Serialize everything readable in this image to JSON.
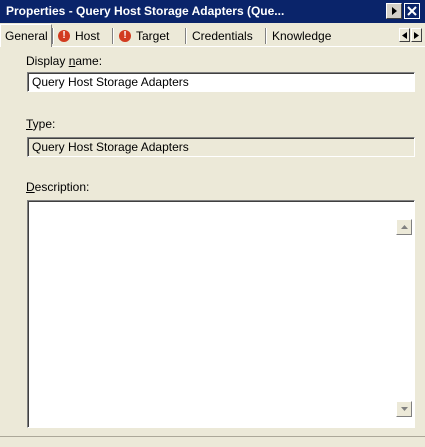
{
  "window": {
    "title": "Properties - Query Host Storage Adapters (Que...",
    "title_bg": "#0a246a"
  },
  "tabs": [
    {
      "label": "General",
      "active": true,
      "icon": null
    },
    {
      "label": "Host",
      "active": false,
      "icon": "warning-icon"
    },
    {
      "label": "Target",
      "active": false,
      "icon": "warning-icon"
    },
    {
      "label": "Credentials",
      "active": false,
      "icon": null
    },
    {
      "label": "Knowledge",
      "active": false,
      "icon": null
    }
  ],
  "form": {
    "display_name_label_pre": "Display ",
    "display_name_label_ul": "n",
    "display_name_label_post": "ame:",
    "display_name_value": "Query Host Storage Adapters",
    "type_label_ul": "T",
    "type_label_post": "ype:",
    "type_value": "Query Host Storage Adapters",
    "description_label_ul": "D",
    "description_label_post": "escription:",
    "description_value": ""
  },
  "warning_glyph": "!"
}
